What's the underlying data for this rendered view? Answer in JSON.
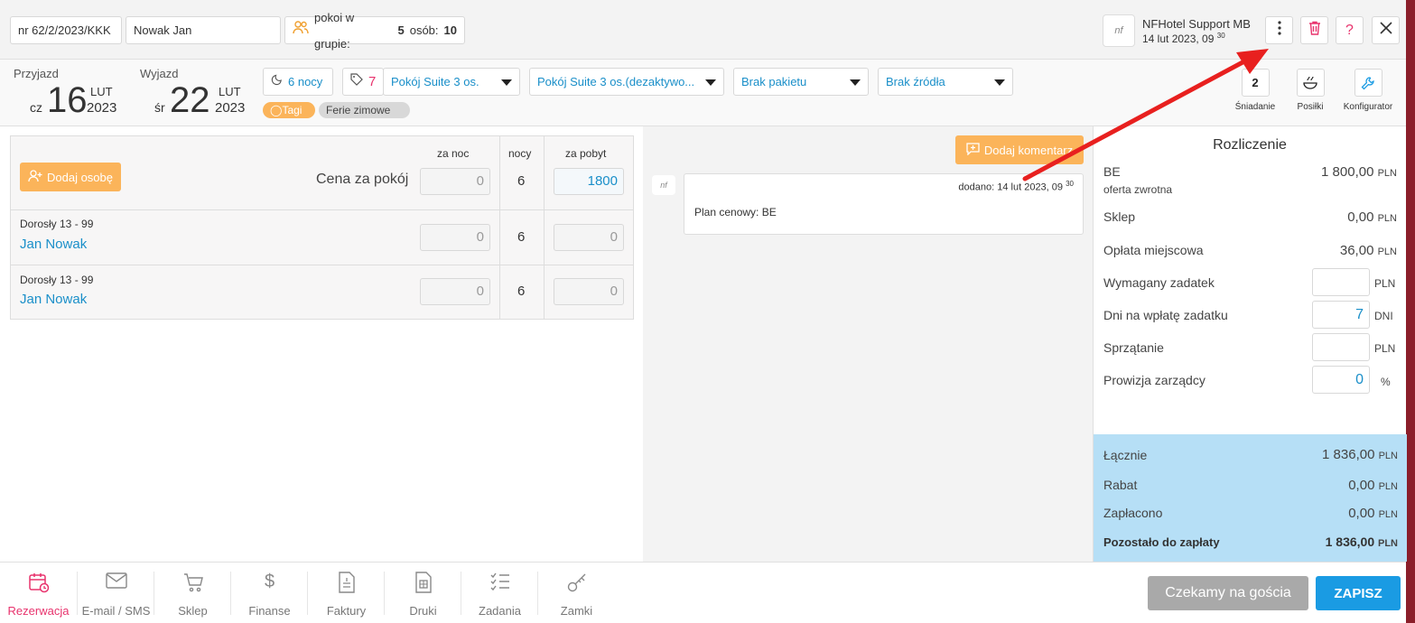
{
  "topbar": {
    "reservation_no": "nr 62/2/2023/KKK",
    "guest_name": "Nowak Jan",
    "group_label": "pokoi w grupie:",
    "group_rooms": "5",
    "group_persons_label": "osób:",
    "group_persons": "10",
    "user_name": "NFHotel Support MB",
    "user_date": "14 lut 2023, 09",
    "user_time_sup": "30",
    "logo_text": "nf"
  },
  "stay": {
    "arrival_label": "Przyjazd",
    "arrival_day": "cz",
    "arrival_num": "16",
    "arrival_month": "LUT",
    "arrival_year": "2023",
    "departure_label": "Wyjazd",
    "departure_day": "śr",
    "departure_num": "22",
    "departure_month": "LUT",
    "departure_year": "2023",
    "nights": "6 nocy",
    "room_number": "7",
    "room_type": "Pokój Suite 3 os.",
    "room_standard": "Pokój Suite 3 os.(dezaktywo...",
    "package": "Brak pakietu",
    "source": "Brak źródła",
    "tags_label": "Tagi",
    "tag_value": "Ferie zimowe"
  },
  "tools": [
    {
      "label": "Śniadanie",
      "value": "2"
    },
    {
      "label": "Posiłki",
      "value": ""
    },
    {
      "label": "Konfigurator",
      "value": ""
    }
  ],
  "guests": {
    "add_person": "Dodaj osobę",
    "col_per_night": "za noc",
    "col_nights": "nocy",
    "col_per_stay": "za pobyt",
    "room_price_label": "Cena za pokój",
    "room_price_night": "0",
    "room_nights": "6",
    "room_price_stay": "1800",
    "rows": [
      {
        "type": "Dorosły 13 - 99",
        "name": "Jan Nowak",
        "night": "0",
        "nights": "6",
        "stay": "0"
      },
      {
        "type": "Dorosły 13 - 99",
        "name": "Jan Nowak",
        "night": "0",
        "nights": "6",
        "stay": "0"
      }
    ]
  },
  "comments": {
    "add_comment": "Dodaj komentarz",
    "added": "dodano: 14 lut 2023, 09",
    "added_sup": "30",
    "text": "Plan cenowy: BE"
  },
  "settlement": {
    "title": "Rozliczenie",
    "be_label": "BE",
    "be_sub": "oferta zwrotna",
    "be_value": "1 800,00",
    "shop_label": "Sklep",
    "shop_value": "0,00",
    "tax_label": "Opłata miejscowa",
    "tax_value": "36,00",
    "deposit_label": "Wymagany zadatek",
    "deposit_value": "",
    "deposit_days_label": "Dni na wpłatę zadatku",
    "deposit_days_value": "7",
    "deposit_days_unit": "DNI",
    "cleaning_label": "Sprzątanie",
    "cleaning_value": "",
    "commission_label": "Prowizja zarządcy",
    "commission_value": "0",
    "commission_unit": "%",
    "currency": "PLN",
    "total_label": "Łącznie",
    "total_value": "1 836,00",
    "discount_label": "Rabat",
    "discount_value": "0,00",
    "paid_label": "Zapłacono",
    "paid_value": "0,00",
    "remaining_label": "Pozostało do zapłaty",
    "remaining_value": "1 836,00"
  },
  "bottom_nav": [
    {
      "label": "Rezerwacja",
      "icon": "calendar-clock-icon",
      "active": true
    },
    {
      "label": "E-mail / SMS",
      "icon": "envelope-icon",
      "active": false
    },
    {
      "label": "Sklep",
      "icon": "cart-icon",
      "active": false
    },
    {
      "label": "Finanse",
      "icon": "dollar-icon",
      "active": false
    },
    {
      "label": "Faktury",
      "icon": "invoice-icon",
      "active": false
    },
    {
      "label": "Druki",
      "icon": "print-doc-icon",
      "active": false
    },
    {
      "label": "Zadania",
      "icon": "checklist-icon",
      "active": false
    },
    {
      "label": "Zamki",
      "icon": "key-icon",
      "active": false
    }
  ],
  "actions": {
    "waiting": "Czekamy na gościa",
    "save": "ZAPISZ"
  },
  "colors": {
    "accent_blue": "#1a9be3",
    "active_pink": "#e8336d",
    "orange": "#fbb45a",
    "totals_bg": "#b6dff6",
    "annotation_red": "#e8201f"
  }
}
